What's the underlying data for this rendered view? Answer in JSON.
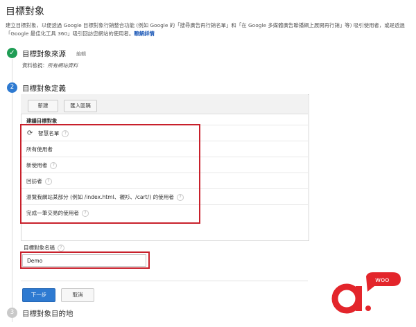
{
  "page": {
    "title": "目標對象",
    "description": "建立目標對象，以便透過 Google 目標對象行銷整合功能 (例如 Google 的「搜尋廣告再行銷名單」和「在 Google 多媒體廣告聯播網上展開再行銷」等) 吸引使用者，或是透過「Google 最佳化工具 360」吸引回訪您網站的使用者。",
    "learn_more": "瞭解詳情"
  },
  "steps": {
    "step1": {
      "check": "✓",
      "title": "目標對象來源",
      "edit": "編輯",
      "sub_label": "資料檢視：",
      "sub_value": "所有網站資料"
    },
    "step2": {
      "number": "2",
      "title": "目標對象定義"
    },
    "step3": {
      "number": "3",
      "title": "目標對象目的地"
    }
  },
  "toolbar": {
    "new_label": "新建",
    "import_label": "匯入區隔"
  },
  "audiences": {
    "header": "建議目標對象",
    "items": [
      {
        "label": "智慧名單",
        "icon": "smart-list-icon",
        "help": "?"
      },
      {
        "label": "所有使用者",
        "help": ""
      },
      {
        "label": "新使用者",
        "help": "?"
      },
      {
        "label": "回訪者",
        "help": "?"
      },
      {
        "label": "瀏覽我網站某部分 (例如 /index.html、襯衫、/cart/) 的使用者",
        "help": "?"
      },
      {
        "label": "完成一筆交易的使用者",
        "help": "?"
      }
    ]
  },
  "audience_name": {
    "label": "目標對象名稱",
    "help": "?",
    "value": "Demo"
  },
  "actions": {
    "next_label": "下一步",
    "cancel_label": "取消"
  },
  "watermark": {
    "text": "woo"
  },
  "colors": {
    "accent": "#2e7ad1",
    "success": "#1f9d55",
    "highlight": "#c8202b",
    "logo": "#e3252b"
  }
}
